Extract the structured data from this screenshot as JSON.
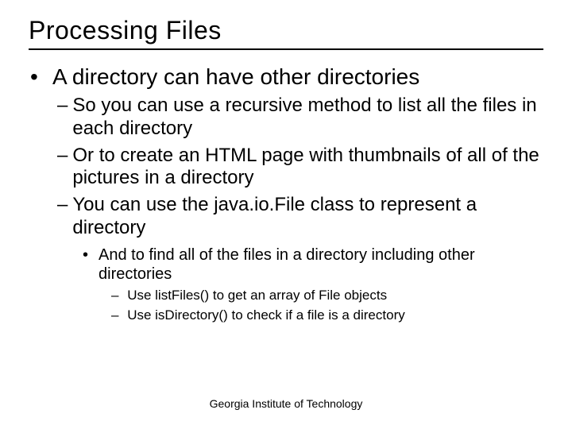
{
  "title": "Processing Files",
  "bullet": "A directory can have other directories",
  "sub1a": "So you can use a recursive method to list all the files in each directory",
  "sub1b": "Or to create an HTML page with thumbnails of all of the pictures in a directory",
  "sub1c": "You can use the java.io.File class to represent a directory",
  "sub2": "And to find all of the files in a directory including other directories",
  "sub3a": "Use listFiles() to get an array of File objects",
  "sub3b": "Use isDirectory() to check if a  file is a directory",
  "footer": "Georgia Institute of Technology"
}
